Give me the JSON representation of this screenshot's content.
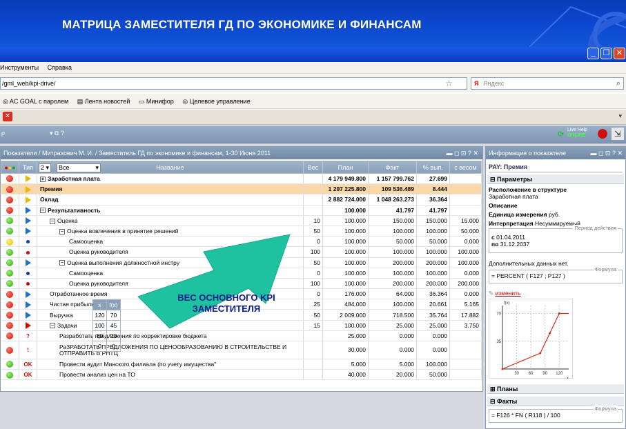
{
  "banner": {
    "title": "МАТРИЦА ЗАМЕСТИТЕЛЯ ГД ПО ЭКОНОМИКЕ И ФИНАНСАМ"
  },
  "browser": {
    "menu": [
      "Инструменты",
      "Справка"
    ],
    "address": "/gml_web/kpi-drive/",
    "search_placeholder": "Яндекс",
    "bookmarks": [
      "AC GOAL с паролем",
      "Лента новостей",
      "Минифор",
      "Целевое управление"
    ]
  },
  "app": {
    "toolbar_left": "р",
    "live_help": "Live Help",
    "live_help_status": "ONLINE"
  },
  "main_panel": {
    "title": "Показатели / Митрахович М. И. / Заместитель ГД по экономике и финансам, 1-30 Июня 2011",
    "filter_level": "2",
    "filter_all": "Все",
    "columns": [
      "Тип",
      "Название",
      "Вес",
      "План",
      "Факт",
      "% вып.",
      "с весом"
    ],
    "rows": [
      {
        "light": "red",
        "type": "flag-o",
        "name": "Заработная плата",
        "indent": 0,
        "exp": "⊞",
        "weight": "",
        "plan": "4 179 949.800",
        "fact": "1 157 799.762",
        "pct": "27.699",
        "w": "",
        "cls": "bold"
      },
      {
        "light": "red",
        "type": "flag-o",
        "name": "Премия",
        "indent": 0,
        "exp": "",
        "weight": "",
        "plan": "1 297 225.800",
        "fact": "109 536.489",
        "pct": "8.444",
        "w": "",
        "cls": "bold sel"
      },
      {
        "light": "red",
        "type": "flag-o",
        "name": "Оклад",
        "indent": 0,
        "exp": "",
        "weight": "",
        "plan": "2 882 724.000",
        "fact": "1 048 263.273",
        "pct": "36.364",
        "w": "",
        "cls": "bold"
      },
      {
        "light": "red",
        "type": "flag",
        "name": "Результативность",
        "indent": 0,
        "exp": "⊟",
        "weight": "",
        "plan": "100.000",
        "fact": "41.797",
        "pct": "41.797",
        "w": "",
        "cls": "bold"
      },
      {
        "light": "green",
        "type": "flag",
        "name": "Оценка",
        "indent": 1,
        "exp": "⊟",
        "weight": "10",
        "plan": "100.000",
        "fact": "150.000",
        "pct": "150.000",
        "w": "15.000",
        "cls": ""
      },
      {
        "light": "green",
        "type": "flag",
        "name": "Оценка вовлечения в принятие решений",
        "indent": 2,
        "exp": "⊟",
        "weight": "50",
        "plan": "100.000",
        "fact": "100.000",
        "pct": "100.000",
        "w": "50.000",
        "cls": ""
      },
      {
        "light": "yellow",
        "type": "dot",
        "name": "Самооценка",
        "indent": 3,
        "exp": "",
        "weight": "0",
        "plan": "100.000",
        "fact": "50.000",
        "pct": "50.000",
        "w": "0.000",
        "cls": ""
      },
      {
        "light": "green",
        "type": "dot-r",
        "name": "Оценка руководителя",
        "indent": 3,
        "exp": "",
        "weight": "100",
        "plan": "100.000",
        "fact": "100.000",
        "pct": "100.000",
        "w": "100.000",
        "cls": ""
      },
      {
        "light": "green",
        "type": "flag",
        "name": "Оценка выполнения должностной инстру",
        "indent": 2,
        "exp": "⊟",
        "weight": "50",
        "plan": "100.000",
        "fact": "200.000",
        "pct": "200.000",
        "w": "100.000",
        "cls": ""
      },
      {
        "light": "green",
        "type": "dot",
        "name": "Самооценка",
        "indent": 3,
        "exp": "",
        "weight": "0",
        "plan": "100.000",
        "fact": "100.000",
        "pct": "100.000",
        "w": "0.000",
        "cls": ""
      },
      {
        "light": "green",
        "type": "dot-r",
        "name": "Оценка руководителя",
        "indent": 3,
        "exp": "",
        "weight": "100",
        "plan": "100.000",
        "fact": "200.000",
        "pct": "200.000",
        "w": "200.000",
        "cls": ""
      },
      {
        "light": "red",
        "type": "flag",
        "name": "Отработанное время",
        "indent": 1,
        "exp": "",
        "weight": "0",
        "plan": "176.000",
        "fact": "64.000",
        "pct": "36.364",
        "w": "0.000",
        "cls": ""
      },
      {
        "light": "red",
        "type": "flag",
        "name": "Чистая прибыль",
        "indent": 1,
        "exp": "",
        "weight": "25",
        "plan": "484.000",
        "fact": "100.000",
        "pct": "20.661",
        "w": "5.165",
        "cls": ""
      },
      {
        "light": "red",
        "type": "flag",
        "name": "Выручка",
        "indent": 1,
        "exp": "",
        "weight": "50",
        "plan": "2 009.000",
        "fact": "718.500",
        "pct": "35.764",
        "w": "17.882",
        "cls": ""
      },
      {
        "light": "red",
        "type": "flag-r",
        "name": "Задачи",
        "indent": 1,
        "exp": "⊟",
        "weight": "15",
        "plan": "100.000",
        "fact": "25.000",
        "pct": "25.000",
        "w": "3.750",
        "cls": ""
      },
      {
        "light": "red",
        "type": "q",
        "name": "Разработать предложения по корректировке бюджета",
        "indent": 2,
        "exp": "",
        "weight": "",
        "plan": "25.000",
        "fact": "0.000",
        "pct": "0.000",
        "w": "",
        "cls": ""
      },
      {
        "light": "red",
        "type": "ex",
        "name": "РаЗРАБОТАТЬ ПРЕДЛОЖЕНИЯ ПО ЦЕНООБРАЗОВАНИЮ В СТРОИТЕЛЬСТВЕ И ОТПРАВИТЬ В РНТЦ",
        "indent": 2,
        "exp": "",
        "weight": "",
        "plan": "30.000",
        "fact": "0.000",
        "pct": "0.000",
        "w": "",
        "cls": "tall"
      },
      {
        "light": "green",
        "type": "ok",
        "name": "Провести аудит Минского филиала (по учету имущества\"",
        "indent": 2,
        "exp": "",
        "weight": "",
        "plan": "5.000",
        "fact": "5.000",
        "pct": "100.000",
        "w": "",
        "cls": ""
      },
      {
        "light": "green",
        "type": "ok",
        "name": "Провести анализ цен на ТО",
        "indent": 2,
        "exp": "",
        "weight": "",
        "plan": "40.000",
        "fact": "20.000",
        "pct": "50.000",
        "w": "",
        "cls": ""
      }
    ]
  },
  "info_panel": {
    "title": "Информация о показателе",
    "code": "PAY: Премия",
    "sec_params": "Параметры",
    "struct_label": "Расположение в структуре",
    "struct_value": "Заработная плата",
    "desc_label": "Описание",
    "unit_label": "Единица измерения",
    "unit_value": "руб.",
    "interp_label": "Интерпретация",
    "interp_value": "Несуммируемый",
    "period_legend": "Период действия",
    "period_from_label": "с",
    "period_from": "01.04.2011",
    "period_to_label": "по",
    "period_to": "31.12.2037",
    "extra_data": "Дополнительных данных нет.",
    "formula_legend": "Формула",
    "formula": "= PERCENT ( F127 ; P127 )",
    "change_link": "изменить",
    "fx_table": [
      [
        "x",
        "f(x)"
      ],
      [
        "120",
        "70"
      ],
      [
        "100",
        "45"
      ],
      [
        "80",
        "20"
      ],
      [
        "0",
        "0"
      ]
    ],
    "sec_plans": "Планы",
    "sec_facts": "Факты",
    "fact_formula_legend": "Формула",
    "fact_formula": "= F126 * FN ( R118 ) / 100"
  },
  "chart_data": {
    "type": "line",
    "x": [
      0,
      80,
      100,
      120
    ],
    "y": [
      0,
      20,
      45,
      70
    ],
    "xticks": [
      "30",
      "60",
      "90",
      "120"
    ],
    "yticks": [
      "70",
      "35"
    ],
    "xlabel": "x",
    "ylabel": "f(x)"
  },
  "annotation": {
    "text": "ВЕС ОСНОВНОГО KPI ЗАМЕСТИТЕЛЯ"
  }
}
